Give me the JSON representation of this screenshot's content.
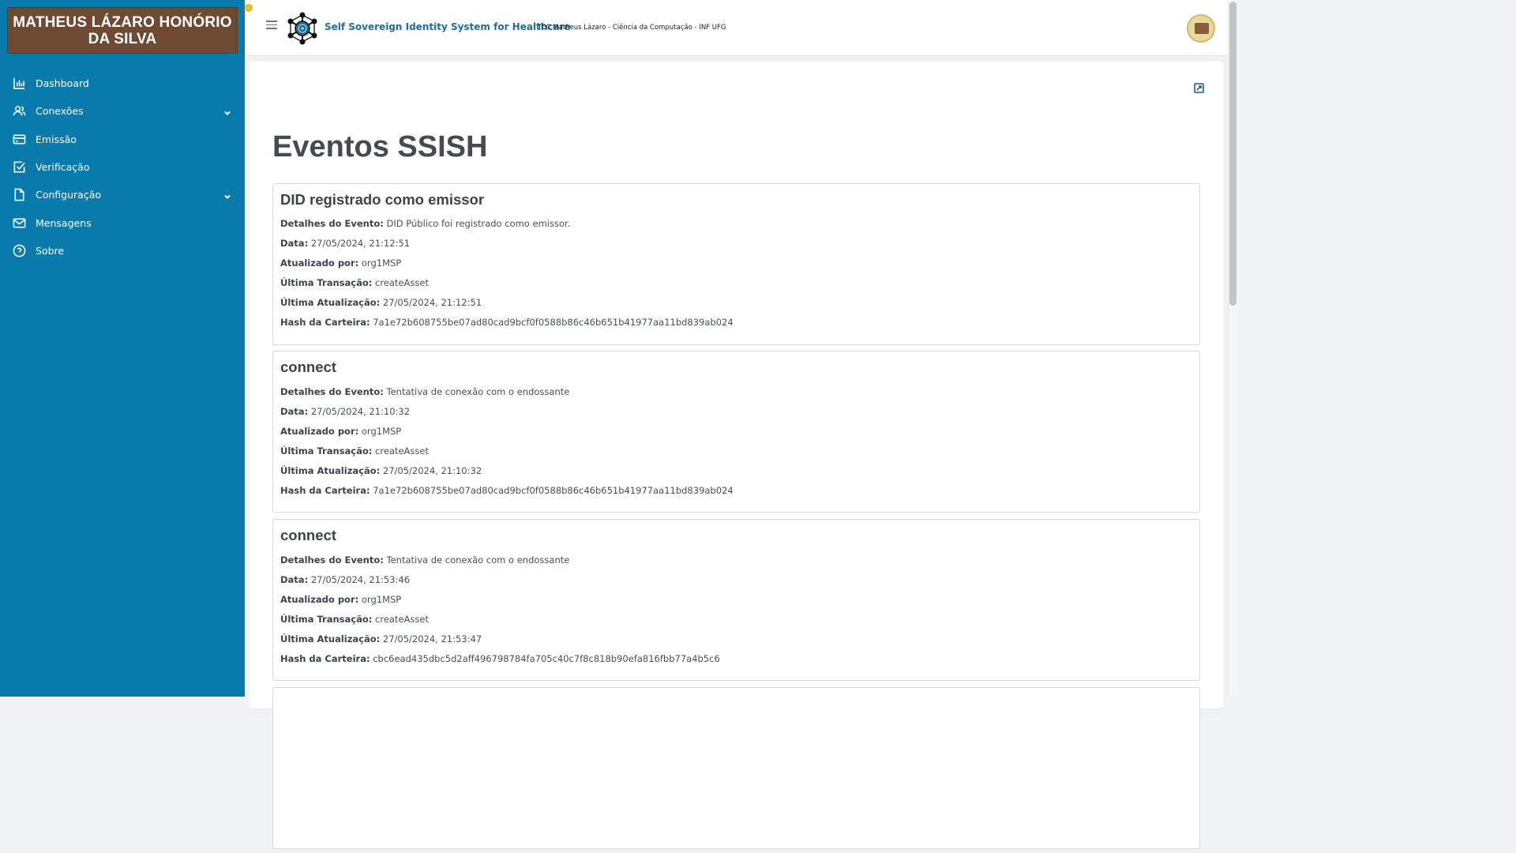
{
  "sidebar": {
    "user_name": "MATHEUS LÁZARO HONÓRIO DA SILVA",
    "items": [
      {
        "label": "Dashboard",
        "icon": "bar-chart-icon"
      },
      {
        "label": "Conexões",
        "icon": "users-icon",
        "expandable": true
      },
      {
        "label": "Emissão",
        "icon": "credit-card-icon"
      },
      {
        "label": "Verificação",
        "icon": "check-square-icon"
      },
      {
        "label": "Configuração",
        "icon": "file-icon",
        "expandable": true
      },
      {
        "label": "Mensagens",
        "icon": "mail-icon"
      },
      {
        "label": "Sobre",
        "icon": "help-circle-icon"
      }
    ]
  },
  "header": {
    "brand": "Self Sovereign Identity System for Healthcare",
    "subtitle": "TCC Matheus Lázaro - Ciência da Computação - INF UFG"
  },
  "main": {
    "title": "Eventos SSISH",
    "labels": {
      "details": "Detalhes do Evento:",
      "date": "Data:",
      "updated_by": "Atualizado por:",
      "last_tx": "Última Transação:",
      "last_update": "Última Atualização:",
      "wallet_hash": "Hash da Carteira:"
    },
    "events": [
      {
        "title": "DID registrado como emissor",
        "details": "DID Público foi registrado como emissor.",
        "date": "27/05/2024, 21:12:51",
        "updated_by": "org1MSP",
        "last_tx": "createAsset",
        "last_update": "27/05/2024, 21:12:51",
        "wallet_hash": "7a1e72b608755be07ad80cad9bcf0f0588b86c46b651b41977aa11bd839ab024"
      },
      {
        "title": "connect",
        "details": "Tentativa de conexão com o endossante",
        "date": "27/05/2024, 21:10:32",
        "updated_by": "org1MSP",
        "last_tx": "createAsset",
        "last_update": "27/05/2024, 21:10:32",
        "wallet_hash": "7a1e72b608755be07ad80cad9bcf0f0588b86c46b651b41977aa11bd839ab024"
      },
      {
        "title": "connect",
        "details": "Tentativa de conexão com o endossante",
        "date": "27/05/2024, 21:53:46",
        "updated_by": "org1MSP",
        "last_tx": "createAsset",
        "last_update": "27/05/2024, 21:53:47",
        "wallet_hash": "cbc6ead435dbc5d2aff496798784fa705c40c7f8c818b90efa816fbb77a4b5c6"
      }
    ]
  }
}
